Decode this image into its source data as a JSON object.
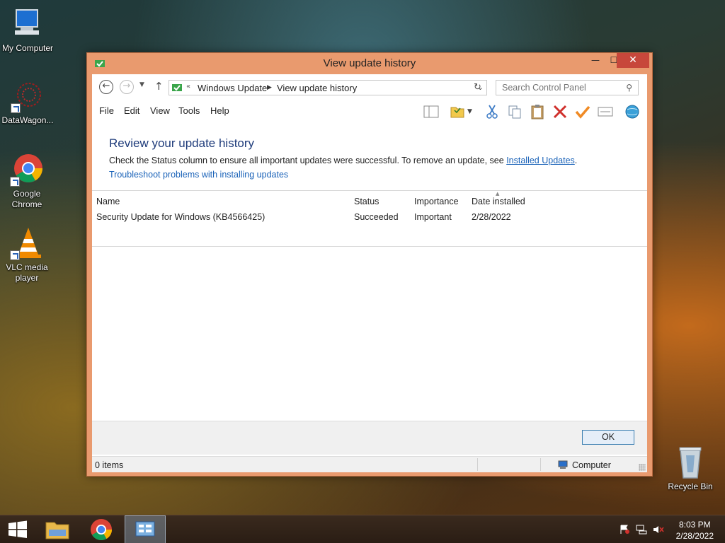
{
  "desktop": {
    "icons": [
      {
        "label": "My Computer"
      },
      {
        "label": "DataWagon..."
      },
      {
        "label": "Google Chrome"
      },
      {
        "label": "VLC media player"
      },
      {
        "label": "Recycle Bin"
      }
    ]
  },
  "window": {
    "title": "View update history",
    "address": {
      "crumbs": [
        "Windows Update",
        "View update history"
      ]
    },
    "search": {
      "placeholder": "Search Control Panel"
    },
    "menu": [
      "File",
      "Edit",
      "View",
      "Tools",
      "Help"
    ],
    "toolbar_icons": [
      "layout-icon",
      "folder-options-icon",
      "cut-icon",
      "copy-icon",
      "paste-icon",
      "delete-icon",
      "check-icon",
      "properties-icon",
      "globe-icon"
    ],
    "heading": "Review your update history",
    "description_prefix": "Check the Status column to ensure all important updates were successful. To remove an update, see ",
    "description_link": "Installed Updates",
    "description_suffix": ".",
    "troubleshoot_link": "Troubleshoot problems with installing updates",
    "table": {
      "columns": [
        "Name",
        "Status",
        "Importance",
        "Date installed"
      ],
      "rows": [
        {
          "name": "Security Update for Windows (KB4566425)",
          "status": "Succeeded",
          "importance": "Important",
          "date": "2/28/2022"
        }
      ]
    },
    "ok_label": "OK",
    "status": {
      "items": "0 items",
      "zone": "Computer"
    }
  },
  "taskbar": {
    "time": "8:03 PM",
    "date": "2/28/2022"
  },
  "colors": {
    "title_frame": "#e99a6e",
    "close_button": "#c7473b",
    "heading": "#1e3b7a",
    "link": "#1a62b8"
  }
}
